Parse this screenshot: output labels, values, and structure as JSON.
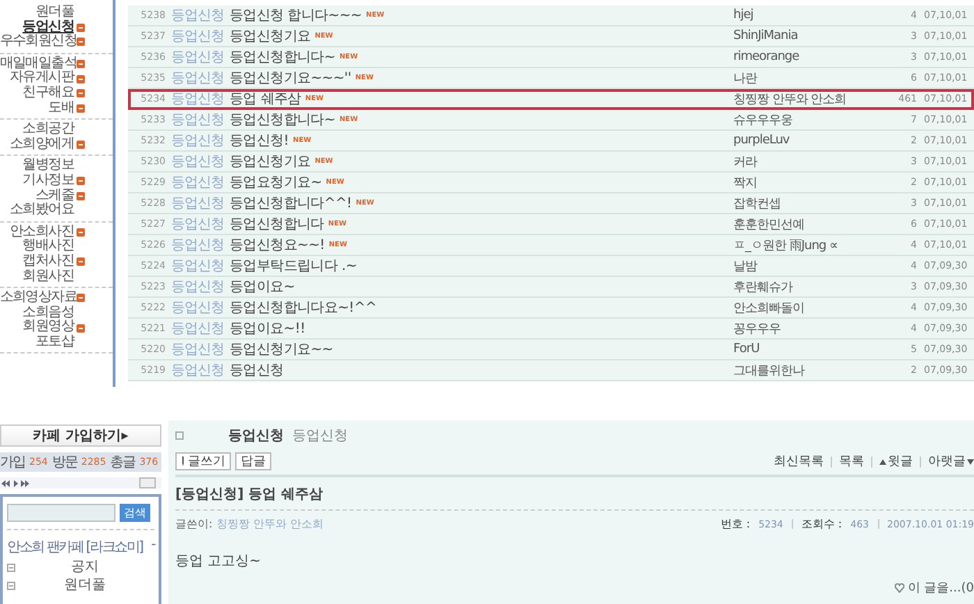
{
  "top_sidebar": {
    "groups": [
      {
        "items": [
          {
            "label": "원더풀",
            "new": false,
            "selected": false
          },
          {
            "label": "등업신청",
            "new": true,
            "selected": true
          },
          {
            "label": "우수회원신청",
            "new": true,
            "selected": false
          }
        ]
      },
      {
        "items": [
          {
            "label": "매일매일출석",
            "new": true,
            "selected": false
          },
          {
            "label": "자유게시판",
            "new": true,
            "selected": false
          },
          {
            "label": "친구해요",
            "new": true,
            "selected": false
          },
          {
            "label": "도배",
            "new": true,
            "selected": false
          }
        ]
      },
      {
        "items": [
          {
            "label": "소희공간",
            "new": false,
            "selected": false
          },
          {
            "label": "소희양에게",
            "new": true,
            "selected": false
          }
        ]
      },
      {
        "items": [
          {
            "label": "월병정보",
            "new": false,
            "selected": false
          },
          {
            "label": "기사정보",
            "new": true,
            "selected": false
          },
          {
            "label": "스케줄",
            "new": true,
            "selected": false
          },
          {
            "label": "소희봤어요",
            "new": false,
            "selected": false
          }
        ]
      },
      {
        "items": [
          {
            "label": "안소희사진",
            "new": true,
            "selected": false
          },
          {
            "label": "행배사진",
            "new": false,
            "selected": false
          },
          {
            "label": "캡처사진",
            "new": true,
            "selected": false
          },
          {
            "label": "회원사진",
            "new": false,
            "selected": false
          }
        ]
      },
      {
        "items": [
          {
            "label": "소희영상자료",
            "new": true,
            "selected": false
          },
          {
            "label": "소희음성",
            "new": false,
            "selected": false
          },
          {
            "label": "회원영상",
            "new": true,
            "selected": false
          },
          {
            "label": "포토샵",
            "new": false,
            "selected": false
          }
        ]
      }
    ]
  },
  "posts": [
    {
      "number": "5238",
      "category": "등업신청",
      "title": "등업신청 합니다~~~",
      "badge": "NEW",
      "author": "hjej",
      "views": "4",
      "date": "07,10,01",
      "selected": false
    },
    {
      "number": "5237",
      "category": "등업신청",
      "title": "등업신청기요",
      "badge": "NEW",
      "author": "ShinJiMania",
      "views": "3",
      "date": "07,10,01",
      "selected": false
    },
    {
      "number": "5236",
      "category": "등업신청",
      "title": "등업신청합니다~",
      "badge": "NEW",
      "author": "rimeorange",
      "views": "3",
      "date": "07,10,01",
      "selected": false
    },
    {
      "number": "5235",
      "category": "등업신청",
      "title": "등업신청기요~~~''",
      "badge": "NEW",
      "author": "나란",
      "views": "6",
      "date": "07,10,01",
      "selected": false
    },
    {
      "number": "5234",
      "category": "등업신청",
      "title": "등업 쉐주삼",
      "badge": "NEW",
      "author": "칭찡짱 안뚜와 안소희",
      "views": "461",
      "date": "07,10,01",
      "selected": true
    },
    {
      "number": "5233",
      "category": "등업신청",
      "title": "등업신청합니다~",
      "badge": "NEW",
      "author": "슈우우우웅",
      "views": "7",
      "date": "07,10,01",
      "selected": false
    },
    {
      "number": "5232",
      "category": "등업신청",
      "title": "등업신청!",
      "badge": "NEW",
      "author": "purpleLuv",
      "views": "2",
      "date": "07,10,01",
      "selected": false
    },
    {
      "number": "5230",
      "category": "등업신청",
      "title": "등업신청기요",
      "badge": "NEW",
      "author": "커라",
      "views": "3",
      "date": "07,10,01",
      "selected": false
    },
    {
      "number": "5229",
      "category": "등업신청",
      "title": "등업요청기요~",
      "badge": "NEW",
      "author": "짝지",
      "views": "2",
      "date": "07,10,01",
      "selected": false
    },
    {
      "number": "5228",
      "category": "등업신청",
      "title": "등업신청합니다^^!",
      "badge": "NEW",
      "author": "잡학컨셉",
      "views": "3",
      "date": "07,10,01",
      "selected": false
    },
    {
      "number": "5227",
      "category": "등업신청",
      "title": "등업신청합니다",
      "badge": "NEW",
      "author": "훈훈한민선예",
      "views": "6",
      "date": "07,10,01",
      "selected": false
    },
    {
      "number": "5226",
      "category": "등업신청",
      "title": "등업신청요~~!",
      "badge": "NEW",
      "author": "ㅍ_ㅇ원한 雨Jung ∝",
      "views": "4",
      "date": "07,10,01",
      "selected": false
    },
    {
      "number": "5224",
      "category": "등업신청",
      "title": "등업부탁드립니다 .~",
      "author": "날밤",
      "views": "4",
      "date": "07,09,30",
      "selected": false
    },
    {
      "number": "5223",
      "category": "등업신청",
      "title": "등업이요~",
      "author": "후란훼슈가",
      "views": "3",
      "date": "07,09,30",
      "selected": false
    },
    {
      "number": "5222",
      "category": "등업신청",
      "title": "등업신청합니다요~!^^",
      "author": "안소희빠돌이",
      "views": "4",
      "date": "07,09,30",
      "selected": false
    },
    {
      "number": "5221",
      "category": "등업신청",
      "title": "등업이요~!!",
      "author": "꽁우우우",
      "views": "4",
      "date": "07,09,30",
      "selected": false
    },
    {
      "number": "5220",
      "category": "등업신청",
      "title": "등업신청기요~~",
      "author": "ForU",
      "views": "5",
      "date": "07,09,30",
      "selected": false
    },
    {
      "number": "5219",
      "category": "등업신청",
      "title": "등업신청",
      "author": "그대를위한나",
      "views": "2",
      "date": "07,09,30",
      "selected": false
    }
  ],
  "cafe_panel": {
    "join_button": "카페 가입하기▸",
    "stats": [
      {
        "label": "가입",
        "value": "254"
      },
      {
        "label": "방문",
        "value": "2285"
      },
      {
        "label": "총글",
        "value": "376"
      }
    ],
    "search_button": "검색",
    "cafe_name": "안소희 팬카페 [라크쇼미]",
    "collapse": "-",
    "menu": [
      {
        "label": "공지"
      },
      {
        "label": "원더풀"
      }
    ]
  },
  "post_view": {
    "board": "등업신청",
    "category": "등업신청",
    "toolbar": [
      "글쓰기",
      "답글"
    ],
    "nav_links": [
      {
        "label": "최신목록",
        "kind": "plain"
      },
      {
        "label": "목록",
        "kind": "plain"
      },
      {
        "label": "윗글",
        "kind": "up"
      },
      {
        "label": "아랫글",
        "kind": "down"
      }
    ],
    "title": "[등업신청] 등업 쉐주삼",
    "author_label": "글쓴이:",
    "author": "칭찡짱 안뚜와 안소희",
    "meta": [
      {
        "label": "번호 :",
        "value": "5234"
      },
      {
        "label": "조회수 :",
        "value": "463"
      },
      {
        "value": "2007.10.01 01:19"
      }
    ],
    "body": "등업 고고싱~",
    "footer": "이 글을...(0"
  }
}
